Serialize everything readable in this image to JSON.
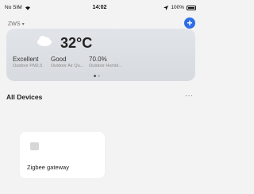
{
  "status_bar": {
    "carrier": "No SIM",
    "time": "14:02",
    "battery_percent": "100%"
  },
  "header": {
    "home_name": "ZWS",
    "add_icon": "plus-icon"
  },
  "weather": {
    "icon": "cloud-icon",
    "temperature": "32°C",
    "metrics": [
      {
        "value": "Excellent",
        "label": "Outdoor PM2.5"
      },
      {
        "value": "Good",
        "label": "Outdoor Air Qu..."
      },
      {
        "value": "70.0%",
        "label": "Outdoor Humid..."
      }
    ],
    "page_indicator": {
      "count": 2,
      "active": 1
    }
  },
  "devices": {
    "section_title": "All Devices",
    "more_icon": "more-horizontal-icon",
    "items": [
      {
        "name": "Zigbee gateway",
        "icon": "device-placeholder-icon"
      }
    ]
  }
}
